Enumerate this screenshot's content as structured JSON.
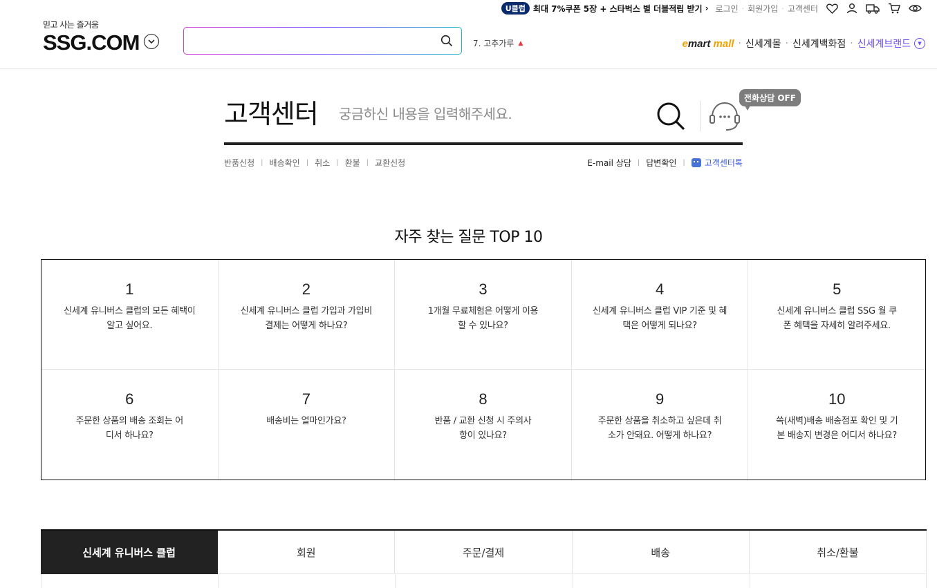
{
  "topbar": {
    "uclub_badge": "U클럽",
    "uclub_promo": "최대 7%쿠폰 5장 + 스타벅스 별 더블적립 받기",
    "links": [
      "로그인",
      "회원가입",
      "고객센터"
    ]
  },
  "logo": {
    "tagline": "믿고 사는 즐거움",
    "name": "SSG.COM"
  },
  "search": {
    "value": "",
    "placeholder": ""
  },
  "rank": {
    "label": "7. 고추가루"
  },
  "malls": {
    "emart_e": "e",
    "emart_mart": "mart",
    "emart_mall": "mall",
    "shinsegae_mall": "신세계몰",
    "shinsegae_dept": "신세계백화점",
    "shinsegae_brand": "신세계브랜드"
  },
  "cs": {
    "title": "고객센터",
    "placeholder": "궁금하신 내용을 입력해주세요.",
    "phone_badge": "전화상담 OFF",
    "quick_left": [
      "반품신청",
      "배송확인",
      "취소",
      "환불",
      "교환신청"
    ],
    "email": "E-mail 상담",
    "answer": "답변확인",
    "chatbot": "고객센터톡"
  },
  "faq": {
    "title": "자주 찾는 질문 TOP 10",
    "items": [
      {
        "num": "1",
        "q": "신세계 유니버스 클럽의 모든 혜택이 알고 싶어요."
      },
      {
        "num": "2",
        "q": "신세계 유니버스 클럽 가입과 가입비 결제는 어떻게 하나요?"
      },
      {
        "num": "3",
        "q": "1개월 무료체험은 어떻게 이용할 수 있나요?"
      },
      {
        "num": "4",
        "q": "신세계 유니버스 클럽 VIP 기준 및 혜택은 어떻게 되나요?"
      },
      {
        "num": "5",
        "q": "신세계 유니버스 클럽 SSG 월 쿠폰 혜택을 자세히 알려주세요."
      },
      {
        "num": "6",
        "q": "주문한 상품의 배송 조회는 어디서 하나요?"
      },
      {
        "num": "7",
        "q": "배송비는 얼마인가요?"
      },
      {
        "num": "8",
        "q": "반품 / 교환 신청 시 주의사항이 있나요?"
      },
      {
        "num": "9",
        "q": "주문한 상품을 취소하고 싶은데 취소가 안돼요. 어떻게 하나요?"
      },
      {
        "num": "10",
        "q": "쓱(새벽)배송 배송점포 확인 및 기본 배송지 변경은 어디서 하나요?"
      }
    ]
  },
  "categories": [
    "신세계 유니버스 클럽",
    "회원",
    "주문/결제",
    "배송",
    "취소/환불"
  ],
  "colors": {
    "accent_purple": "#6a4cf0",
    "uclub_navy": "#0a2a6b",
    "rank_up_red": "#e8343a",
    "emart_yellow": "#f4a000"
  }
}
